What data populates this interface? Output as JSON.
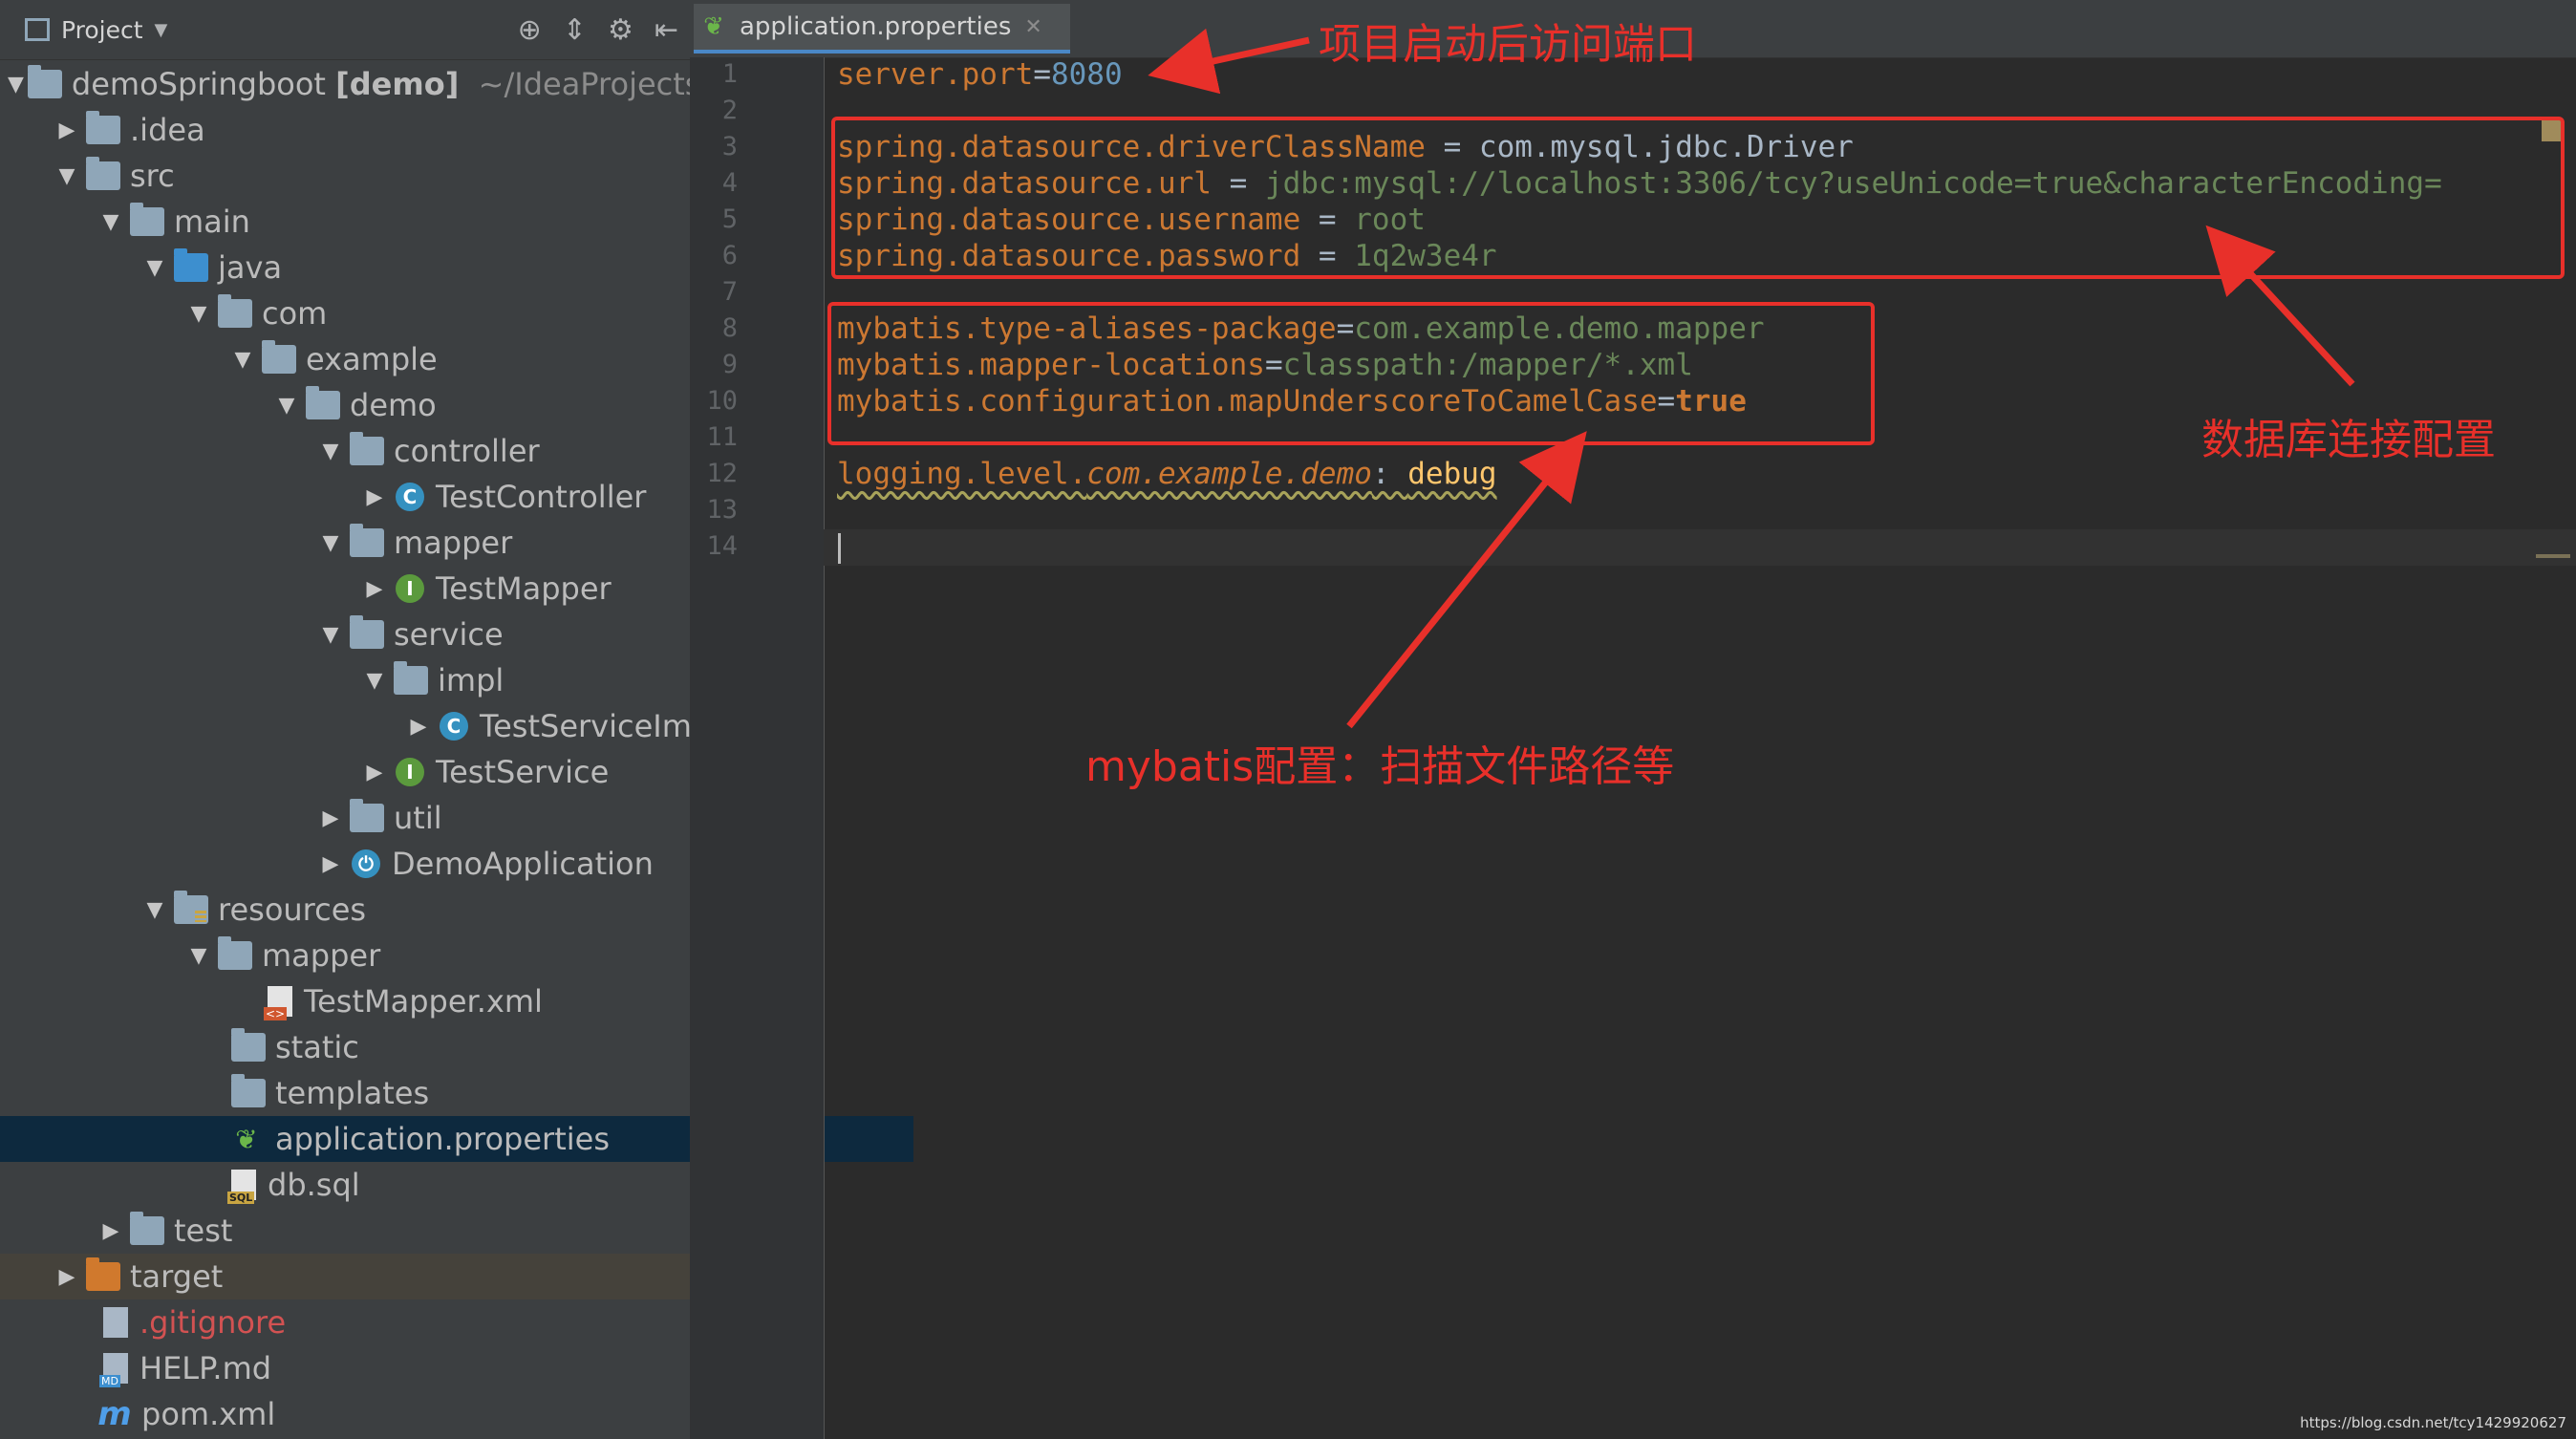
{
  "project_panel": {
    "title": "Project",
    "tree": [
      {
        "label": "demoSpringboot",
        "suffix": "[demo]",
        "path": "~/IdeaProjects/",
        "depth": 0,
        "expanded": true,
        "icon": "module-folder"
      },
      {
        "label": ".idea",
        "depth": 1,
        "expanded": false,
        "icon": "folder"
      },
      {
        "label": "src",
        "depth": 1,
        "expanded": true,
        "icon": "folder"
      },
      {
        "label": "main",
        "depth": 2,
        "expanded": true,
        "icon": "folder"
      },
      {
        "label": "java",
        "depth": 3,
        "expanded": true,
        "icon": "source-folder"
      },
      {
        "label": "com",
        "depth": 4,
        "expanded": true,
        "icon": "package"
      },
      {
        "label": "example",
        "depth": 5,
        "expanded": true,
        "icon": "package"
      },
      {
        "label": "demo",
        "depth": 6,
        "expanded": true,
        "icon": "package"
      },
      {
        "label": "controller",
        "depth": 7,
        "expanded": true,
        "icon": "package"
      },
      {
        "label": "TestController",
        "depth": 8,
        "expanded": false,
        "icon": "class"
      },
      {
        "label": "mapper",
        "depth": 7,
        "expanded": true,
        "icon": "package"
      },
      {
        "label": "TestMapper",
        "depth": 8,
        "expanded": false,
        "icon": "interface"
      },
      {
        "label": "service",
        "depth": 7,
        "expanded": true,
        "icon": "package"
      },
      {
        "label": "impl",
        "depth": 8,
        "expanded": true,
        "icon": "package"
      },
      {
        "label": "TestServiceIm",
        "depth": 9,
        "expanded": false,
        "icon": "class"
      },
      {
        "label": "TestService",
        "depth": 8,
        "expanded": false,
        "icon": "interface"
      },
      {
        "label": "util",
        "depth": 7,
        "expanded": false,
        "icon": "package"
      },
      {
        "label": "DemoApplication",
        "depth": 7,
        "expanded": false,
        "icon": "spring-boot-class"
      },
      {
        "label": "resources",
        "depth": 3,
        "expanded": true,
        "icon": "resources-folder"
      },
      {
        "label": "mapper",
        "depth": 4,
        "expanded": true,
        "icon": "package"
      },
      {
        "label": "TestMapper.xml",
        "depth": 5,
        "icon": "xml-file"
      },
      {
        "label": "static",
        "depth": 4,
        "icon": "package"
      },
      {
        "label": "templates",
        "depth": 4,
        "icon": "package"
      },
      {
        "label": "application.properties",
        "depth": 4,
        "icon": "spring-properties",
        "selected": true
      },
      {
        "label": "db.sql",
        "depth": 4,
        "icon": "sql-file"
      },
      {
        "label": "test",
        "depth": 2,
        "expanded": false,
        "icon": "folder"
      },
      {
        "label": "target",
        "depth": 1,
        "expanded": false,
        "icon": "excluded-folder",
        "highlighted": true
      },
      {
        "label": ".gitignore",
        "depth": 1,
        "icon": "gitignore-file",
        "ignored": true
      },
      {
        "label": "HELP.md",
        "depth": 1,
        "icon": "md-file"
      },
      {
        "label": "pom.xml",
        "depth": 1,
        "icon": "maven-file"
      }
    ]
  },
  "editor": {
    "tab_label": "application.properties",
    "line_numbers": [
      "1",
      "2",
      "3",
      "4",
      "5",
      "6",
      "7",
      "8",
      "9",
      "10",
      "11",
      "12",
      "13",
      "14"
    ],
    "lines": {
      "l1_key": "server.port",
      "l1_eq": "=",
      "l1_val": "8080",
      "l3_key": "spring.datasource.driverClassName",
      "l3_eq": " = ",
      "l3_val": "com.mysql.jdbc.Driver",
      "l4_key": "spring.datasource.url",
      "l4_eq": " = ",
      "l4_val": "jdbc:mysql://localhost:3306/tcy?useUnicode=true&characterEncoding=",
      "l5_key": "spring.datasource.username",
      "l5_eq": " = ",
      "l5_val": "root",
      "l6_key": "spring.datasource.password",
      "l6_eq": " = ",
      "l6_val": "1q2w3e4r",
      "l8_key": "mybatis.type-aliases-package",
      "l8_eq": "=",
      "l8_val": "com.example.demo.mapper",
      "l9_key": "mybatis.mapper-locations",
      "l9_eq": "=",
      "l9_val": "classpath:/mapper/*.xml",
      "l10_key": "mybatis.configuration.mapUnderscoreToCamelCase",
      "l10_eq": "=",
      "l10_val": "true",
      "l12_key1": "logging.level.",
      "l12_key2": "com.example.demo",
      "l12_colon": ": ",
      "l12_val": "debug"
    }
  },
  "annotations": {
    "port_note": "项目启动后访问端口",
    "datasource_note": "数据库连接配置",
    "mybatis_note": "mybatis配置：扫描文件路径等",
    "color": "#e8302a"
  },
  "watermark": "https://blog.csdn.net/tcy1429920627"
}
